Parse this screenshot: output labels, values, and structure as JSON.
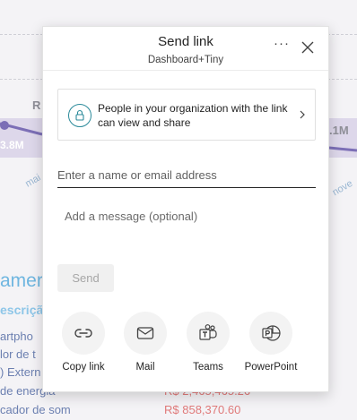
{
  "background": {
    "chart_labels": [
      "R",
      "3.8M",
      ".1M"
    ],
    "axis_labels": [
      "mai",
      "nove"
    ],
    "section_title": "amer",
    "section_subtitle": "escriçã",
    "rows": [
      {
        "name": "artpho",
        "value": ""
      },
      {
        "name": "lor de t",
        "value": ""
      },
      {
        "name": ") Extern",
        "value": ""
      },
      {
        "name": " de energia",
        "value": "R$ 2,465,465.26"
      },
      {
        "name": "cador de som",
        "value": "R$ 858,370.60"
      }
    ]
  },
  "dialog": {
    "title": "Send link",
    "subtitle": "Dashboard+Tiny",
    "more_label": "···",
    "access_text": "People in your organization with the link can view and share",
    "name_placeholder": "Enter a name or email address",
    "message_placeholder": "Add a message (optional)",
    "send_label": "Send",
    "share_options": [
      {
        "label": "Copy link",
        "icon": "link-icon"
      },
      {
        "label": "Mail",
        "icon": "mail-icon"
      },
      {
        "label": "Teams",
        "icon": "teams-icon"
      },
      {
        "label": "PowerPoint",
        "icon": "powerpoint-icon"
      }
    ]
  },
  "colors": {
    "accent_teal": "#2a8a9a",
    "background_band": "#ddd7ea",
    "disabled_text": "#a6a6a6"
  }
}
